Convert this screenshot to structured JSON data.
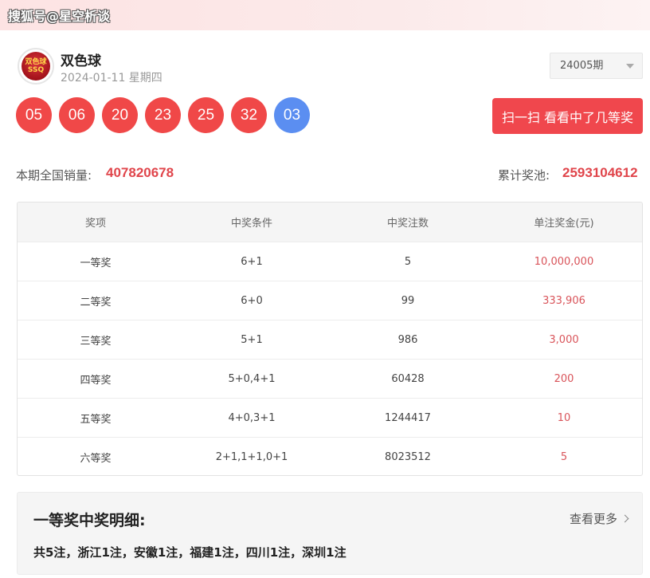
{
  "watermark": "搜狐号@星空析谈",
  "header": {
    "logo_text_top": "双色球",
    "logo_text_bottom": "SSQ",
    "lottery_name": "双色球",
    "draw_date": "2024-01-11 星期四",
    "period": "24005期"
  },
  "balls": {
    "red": [
      "05",
      "06",
      "20",
      "23",
      "25",
      "32"
    ],
    "blue": "03"
  },
  "scan_button": "扫一扫 看看中了几等奖",
  "stats": {
    "sales_label": "本期全国销量:",
    "sales_value": "407820678",
    "pool_label": "累计奖池:",
    "pool_value": "2593104612"
  },
  "table": {
    "headers": [
      "奖项",
      "中奖条件",
      "中奖注数",
      "单注奖金(元)"
    ],
    "rows": [
      [
        "一等奖",
        "6+1",
        "5",
        "10,000,000"
      ],
      [
        "二等奖",
        "6+0",
        "99",
        "333,906"
      ],
      [
        "三等奖",
        "5+1",
        "986",
        "3,000"
      ],
      [
        "四等奖",
        "5+0,4+1",
        "60428",
        "200"
      ],
      [
        "五等奖",
        "4+0,3+1",
        "1244417",
        "10"
      ],
      [
        "六等奖",
        "2+1,1+1,0+1",
        "8023512",
        "5"
      ]
    ]
  },
  "detail": {
    "title": "一等奖中奖明细:",
    "view_more": "查看更多",
    "text": "共5注，浙江1注，安徽1注，福建1注，四川1注，深圳1注"
  },
  "colors": {
    "red_ball": "#f04848",
    "blue_ball": "#5b8ef1",
    "accent": "#e0454b"
  }
}
